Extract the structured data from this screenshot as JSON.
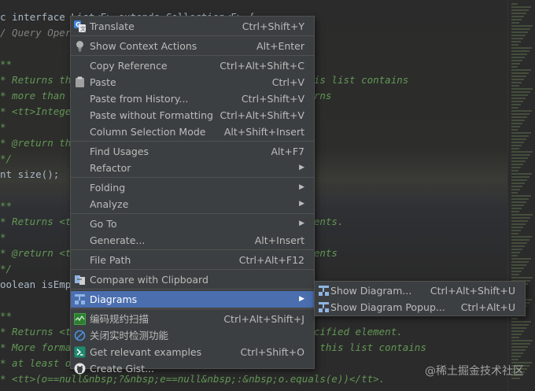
{
  "code_lines": [
    {
      "t": "c interface List<E> extends Collection<E> {",
      "cls": "plain"
    },
    {
      "t": "/ Query Operations",
      "cls": "gutter-line"
    },
    {
      "t": "",
      "cls": "plain"
    },
    {
      "t": "**",
      "cls": "cm"
    },
    {
      "t": "* Returns the number of elements in this list.  If this list contains",
      "cls": "cm"
    },
    {
      "t": "* more than <tt>Integer.MAX_VALUE</tt> elements, returns",
      "cls": "cm"
    },
    {
      "t": "* <tt>Integer.MAX_VALUE</tt>.",
      "cls": "cm"
    },
    {
      "t": "*",
      "cls": "cm"
    },
    {
      "t": "* @return the number of elements in this list",
      "cls": "cm"
    },
    {
      "t": "*/",
      "cls": "cm"
    },
    {
      "t": "nt size();",
      "cls": "plain"
    },
    {
      "t": "",
      "cls": "plain"
    },
    {
      "t": "**",
      "cls": "cm"
    },
    {
      "t": "* Returns <tt>true</tt> if this list contains no elements.",
      "cls": "cm"
    },
    {
      "t": "*",
      "cls": "cm"
    },
    {
      "t": "* @return <tt>true</tt> if this list contains no elements",
      "cls": "cm"
    },
    {
      "t": "*/",
      "cls": "cm"
    },
    {
      "t": "oolean isEmpty();",
      "cls": "plain"
    },
    {
      "t": "",
      "cls": "plain"
    },
    {
      "t": "**",
      "cls": "cm"
    },
    {
      "t": "* Returns <tt>true</tt> if this list contains the specified element.",
      "cls": "cm"
    },
    {
      "t": "* More formally, returns <tt>true</tt> if and only if this list contains",
      "cls": "cm"
    },
    {
      "t": "* at least one element <tt>e</tt> such that",
      "cls": "cm"
    },
    {
      "t": "* <tt>(o==null&nbsp;?&nbsp;e==null&nbsp;:&nbsp;o.equals(e))</tt>.",
      "cls": "cm"
    }
  ],
  "menu": {
    "groups": [
      [
        {
          "label": "Translate",
          "shortcut": "Ctrl+Shift+Y",
          "icon": "translate-icon"
        }
      ],
      [
        {
          "label": "Show Context Actions",
          "shortcut": "Alt+Enter",
          "icon": "lightbulb-icon"
        }
      ],
      [
        {
          "label": "Copy Reference",
          "shortcut": "Ctrl+Alt+Shift+C",
          "icon": ""
        },
        {
          "label": "Paste",
          "shortcut": "Ctrl+V",
          "icon": "clipboard-icon"
        },
        {
          "label": "Paste from History...",
          "shortcut": "Ctrl+Shift+V",
          "icon": ""
        },
        {
          "label": "Paste without Formatting",
          "shortcut": "Ctrl+Alt+Shift+V",
          "icon": ""
        },
        {
          "label": "Column Selection Mode",
          "shortcut": "Alt+Shift+Insert",
          "icon": ""
        }
      ],
      [
        {
          "label": "Find Usages",
          "shortcut": "Alt+F7",
          "icon": ""
        },
        {
          "label": "Refactor",
          "shortcut": "",
          "submenu": true,
          "icon": ""
        }
      ],
      [
        {
          "label": "Folding",
          "shortcut": "",
          "submenu": true,
          "icon": ""
        },
        {
          "label": "Analyze",
          "shortcut": "",
          "submenu": true,
          "icon": ""
        }
      ],
      [
        {
          "label": "Go To",
          "shortcut": "",
          "submenu": true,
          "icon": ""
        },
        {
          "label": "Generate...",
          "shortcut": "Alt+Insert",
          "icon": ""
        }
      ],
      [
        {
          "label": "File Path",
          "shortcut": "Ctrl+Alt+F12",
          "icon": ""
        }
      ],
      [
        {
          "label": "Compare with Clipboard",
          "shortcut": "",
          "icon": "compare-icon"
        }
      ],
      [
        {
          "label": "Diagrams",
          "shortcut": "",
          "submenu": true,
          "selected": true,
          "icon": "diagram-icon"
        }
      ],
      [
        {
          "label": "编码规约扫描",
          "shortcut": "Ctrl+Alt+Shift+J",
          "icon": "scan-icon"
        },
        {
          "label": "关闭实时检测功能",
          "shortcut": "",
          "icon": "block-icon"
        },
        {
          "label": "Get relevant examples",
          "shortcut": "Ctrl+Shift+O",
          "icon": "examples-icon"
        },
        {
          "label": "Create Gist...",
          "shortcut": "",
          "icon": "github-icon"
        }
      ]
    ]
  },
  "submenu": {
    "items": [
      {
        "label": "Show Diagram...",
        "shortcut": "Ctrl+Alt+Shift+U",
        "icon": "diagram-icon"
      },
      {
        "label": "Show Diagram Popup...",
        "shortcut": "Ctrl+Alt+U",
        "icon": "diagram-icon"
      }
    ]
  },
  "watermark": "@稀土掘金技术社区",
  "colors": {
    "menu_bg": "#3c3f41",
    "selected_bg": "#4b6eaf",
    "separator": "#515151",
    "editor_bg": "#2b2b2b"
  }
}
